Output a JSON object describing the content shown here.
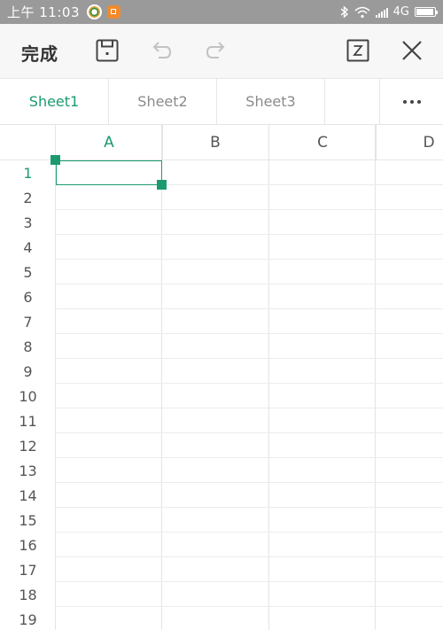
{
  "status_bar": {
    "time": "上午 11:03",
    "network": "4G"
  },
  "toolbar": {
    "done_label": "完成",
    "icons": [
      "save-icon",
      "undo-icon",
      "redo-icon",
      "toggle-box-icon",
      "close-icon"
    ]
  },
  "tabs": [
    {
      "label": "Sheet1",
      "active": true
    },
    {
      "label": "Sheet2",
      "active": false
    },
    {
      "label": "Sheet3",
      "active": false
    }
  ],
  "grid": {
    "columns": [
      "A",
      "B",
      "C",
      "D"
    ],
    "rows": [
      "1",
      "2",
      "3",
      "4",
      "5",
      "6",
      "7",
      "8",
      "9",
      "10",
      "11",
      "12",
      "13",
      "14",
      "15",
      "16",
      "17",
      "18",
      "19"
    ],
    "selected_cell": "A1"
  },
  "colors": {
    "accent": "#1b9a72",
    "status_bar_bg": "#9a9a9a",
    "toolbar_bg": "#f7f7f7"
  }
}
